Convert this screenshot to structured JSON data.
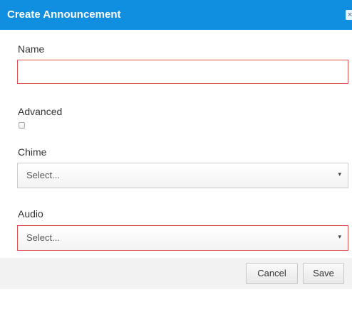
{
  "dialog": {
    "title": "Create Announcement",
    "close_icon": "close-icon",
    "close_glyph": "×"
  },
  "form": {
    "name_label": "Name",
    "name_value": "",
    "advanced_label": "Advanced",
    "advanced_checked": false,
    "chime_label": "Chime",
    "chime_value": "Select...",
    "audio_label": "Audio",
    "audio_value": "Select...",
    "caret_icon": "caret-down-icon",
    "caret_glyph": "▾"
  },
  "footer": {
    "cancel_label": "Cancel",
    "save_label": "Save"
  },
  "colors": {
    "titlebar": "#108ee0",
    "invalid_border": "#e05050",
    "footer_bg": "#f2f2f2"
  }
}
